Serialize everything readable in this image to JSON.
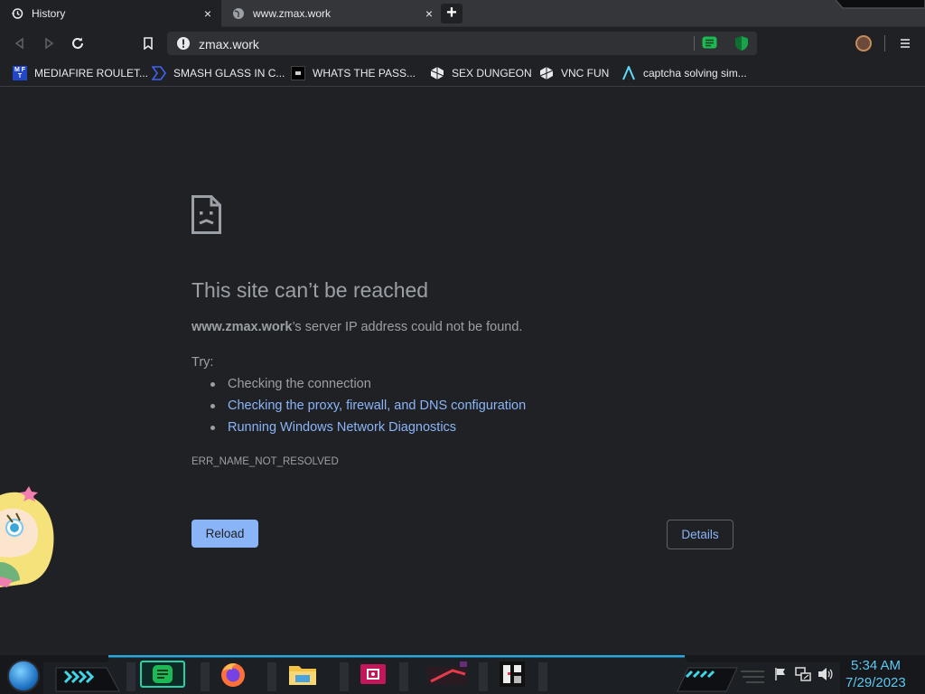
{
  "tabs": [
    {
      "label": "History",
      "icon": "history-icon"
    },
    {
      "label": "www.zmax.work",
      "icon": "globe-icon"
    }
  ],
  "new_tab_label": "+",
  "close_glyph": "×",
  "address_bar": {
    "url": "zmax.work",
    "icon": "info-warning-icon"
  },
  "bookmarks": [
    {
      "label": "MEDIAFIRE ROULET...",
      "icon": "mediafire-icon"
    },
    {
      "label": "SMASH GLASS IN C...",
      "icon": "smash-glass-icon"
    },
    {
      "label": "WHATS THE PASS...",
      "icon": "bookmark-dark-icon"
    },
    {
      "label": "SEX DUNGEON",
      "icon": "dungeon-icon"
    },
    {
      "label": "VNC FUN",
      "icon": "vnc-icon"
    },
    {
      "label": "captcha solving sim...",
      "icon": "captcha-icon"
    }
  ],
  "error_page": {
    "title": "This site can’t be reached",
    "host": "www.zmax.work",
    "message_rest": "’s server IP address could not be found.",
    "try_label": "Try:",
    "suggestions": [
      {
        "text": "Checking the connection",
        "link": false
      },
      {
        "text": "Checking the proxy, firewall, and DNS configuration",
        "link": true
      },
      {
        "text": "Running Windows Network Diagnostics",
        "link": true
      }
    ],
    "error_code": "ERR_NAME_NOT_RESOLVED",
    "reload_label": "Reload",
    "details_label": "Details"
  },
  "taskbar": {
    "time": "5:34 AM",
    "date": "7/29/2023"
  },
  "colors": {
    "accent": "#8ab4f8",
    "background": "#202124",
    "text_muted": "#9aa0a6",
    "clock": "#5ec8f0"
  }
}
